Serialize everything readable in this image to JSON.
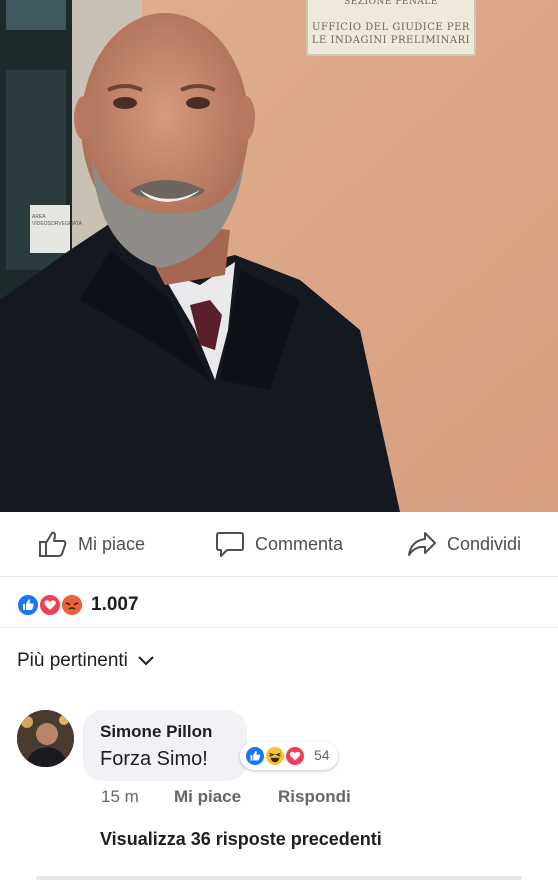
{
  "photo": {
    "plaque_lines": [
      "SEZIONE PENALE",
      "UFFICIO DEL GIUDICE PER",
      "LE INDAGINI PRELIMINARI"
    ],
    "door_sign_lines": [
      "AREA",
      "VIDEOSORVEGLIATA"
    ]
  },
  "actions": {
    "like_label": "Mi piace",
    "comment_label": "Commenta",
    "share_label": "Condividi"
  },
  "reactions_summary": {
    "icons": [
      "like-icon",
      "love-icon",
      "angry-icon"
    ],
    "count": "1.007"
  },
  "sort": {
    "label": "Più pertinenti"
  },
  "comment": {
    "author": "Simone Pillon",
    "text": "Forza Simo!",
    "reaction_icons": [
      "like-icon",
      "haha-icon",
      "love-icon"
    ],
    "reaction_count": "54",
    "time": "15 m",
    "like_label": "Mi piace",
    "reply_label": "Rispondi"
  },
  "view_replies": "Visualizza 36 risposte precedenti",
  "colors": {
    "like_blue": "#1877f2",
    "love_red": "#f33e58",
    "angry_orange": "#f5a33b",
    "wall": "#d9a487"
  }
}
